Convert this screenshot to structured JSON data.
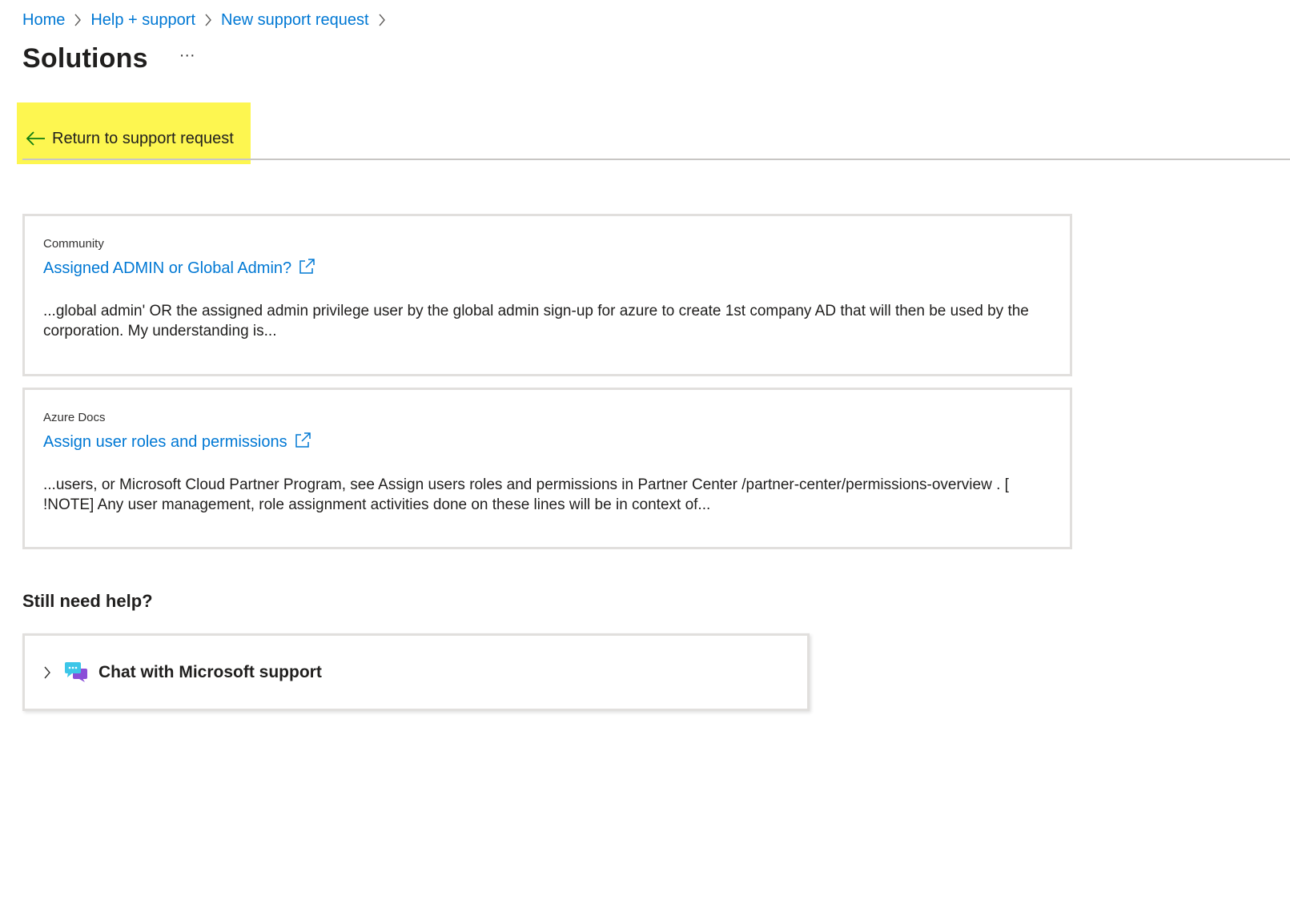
{
  "breadcrumb": {
    "items": [
      "Home",
      "Help + support",
      "New support request"
    ]
  },
  "header": {
    "title": "Solutions",
    "more_label": "···"
  },
  "return_link": {
    "label": "Return to support request"
  },
  "solutions": [
    {
      "source": "Community",
      "title": "Assigned ADMIN or Global Admin?",
      "snippet": "...global admin' OR the assigned admin privilege user by the global admin sign-up for azure to create 1st company AD that will then be used by the corporation. My understanding is..."
    },
    {
      "source": "Azure Docs",
      "title": "Assign user roles and permissions",
      "snippet": "...users, or Microsoft Cloud Partner Program, see Assign users roles and permissions in Partner Center /partner-center/permissions-overview . [ !NOTE] Any user management, role assignment activities done on these lines will be in context of..."
    }
  ],
  "help": {
    "heading": "Still need help?",
    "chat_label": "Chat with Microsoft support"
  },
  "colors": {
    "link": "#0078d4",
    "highlight": "#fdf650",
    "text": "#201f1e",
    "border": "#e1dfdd"
  },
  "icons": {
    "breadcrumb_separator": "chevron-right-icon",
    "return": "arrow-left-icon",
    "external_link": "external-link-icon",
    "chat_expand": "chevron-right-icon",
    "chat": "chat-bubbles-icon"
  }
}
